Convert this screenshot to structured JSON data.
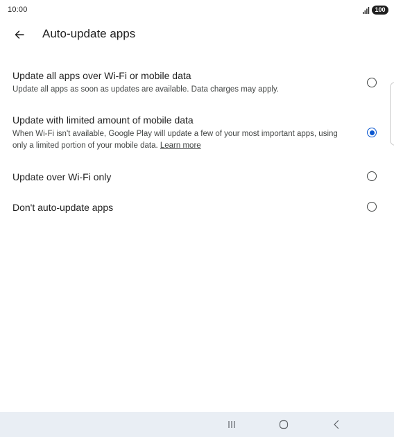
{
  "status_bar": {
    "time": "10:00",
    "battery": "100",
    "signal_icon": "signal-bars-icon"
  },
  "app_bar": {
    "back_icon": "arrow-back-icon",
    "title": "Auto-update apps"
  },
  "options": [
    {
      "title": "Update all apps over Wi-Fi or mobile data",
      "description": "Update all apps as soon as updates are available. Data charges may apply.",
      "selected": false
    },
    {
      "title": "Update with limited amount of mobile data",
      "description": "When Wi-Fi isn't available, Google Play will update a few of your most important apps, using only a limited portion of your mobile data.",
      "link": "Learn more",
      "selected": true
    },
    {
      "title": "Update over Wi-Fi only",
      "selected": false
    },
    {
      "title": "Don't auto-update apps",
      "selected": false
    }
  ],
  "colors": {
    "accent": "#0b57d0",
    "text_primary": "#1f1f1f",
    "text_secondary": "#444746",
    "nav_bar": "#e9eef4"
  },
  "nav_bar": {
    "recents_icon": "recents-icon",
    "home_icon": "home-icon",
    "back_icon": "nav-back-icon"
  }
}
